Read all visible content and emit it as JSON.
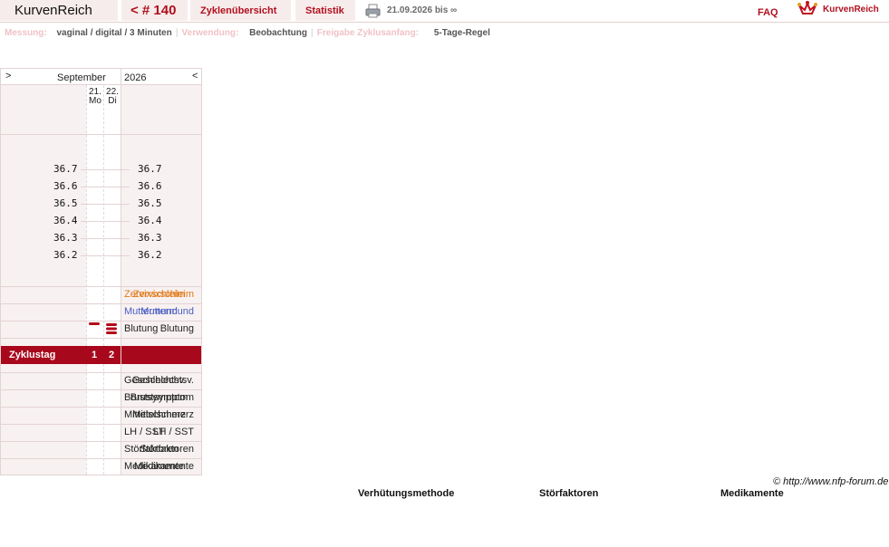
{
  "header": {
    "brand": "KurvenReich",
    "cycle_label": "< # 140",
    "tabs": [
      "Zyklenübersicht",
      "Statistik"
    ],
    "date_range": "21.09.2026 bis ∞",
    "faq": "FAQ",
    "logo_text": "KurvenReich"
  },
  "settings": {
    "measure_label": "Messung:",
    "measure_value": "vaginal / digital / 3 Minuten",
    "usage_label": "Verwendung:",
    "usage_value": "Beobachtung",
    "release_label": "Freigabe Zyklusanfang:",
    "release_value": "5-Tage-Regel"
  },
  "chart": {
    "prev": ">",
    "next": "<",
    "month": "September",
    "year": "2026",
    "days": [
      {
        "date": "21.",
        "weekday": "Mo",
        "cycle_day": "1",
        "bleeding": 1
      },
      {
        "date": "22.",
        "weekday": "Di",
        "cycle_day": "2",
        "bleeding": 3
      }
    ],
    "temps": [
      "36.7",
      "36.6",
      "36.5",
      "36.4",
      "36.3",
      "36.2"
    ],
    "rows": {
      "cervix": "Zervixschleim",
      "cervix_pos": "Muttermund",
      "bleeding": "Blutung",
      "cycle_day": "Zyklustag",
      "intercourse": "Geschlechtsv.",
      "breast": "Brustsymptom",
      "mittel": "Mittelschmerz",
      "lh": "LH / SST",
      "disturb": "Störfaktoren",
      "meds": "Medikamente"
    },
    "colors": {
      "cervix": "#e07a1a",
      "cervix_pos": "#4a5ec4",
      "accent": "#a8081c"
    }
  },
  "copyright": "© http://www.nfp-forum.de",
  "legend": [
    "Verhütungsmethode",
    "Störfaktoren",
    "Medikamente"
  ]
}
